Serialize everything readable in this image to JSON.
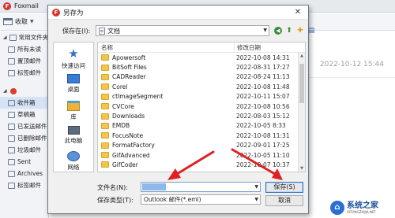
{
  "foxmail": {
    "app_title": "Foxmail",
    "toolbar_inbox_label": "收取",
    "sidebar": [
      {
        "label": "常用文件夹",
        "kind": "group"
      },
      {
        "label": "所有未读",
        "kind": "sub"
      },
      {
        "label": "置顶邮件",
        "kind": "sub"
      },
      {
        "label": "标签邮件",
        "kind": "sub"
      },
      {
        "label": "",
        "kind": "account"
      },
      {
        "label": "收件箱",
        "kind": "sub",
        "highlighted": true
      },
      {
        "label": "草稿箱",
        "kind": "sub"
      },
      {
        "label": "已发送邮件",
        "kind": "sub"
      },
      {
        "label": "已删除邮件",
        "kind": "sub"
      },
      {
        "label": "垃圾邮件",
        "kind": "sub"
      },
      {
        "label": "Sent",
        "kind": "sub"
      },
      {
        "label": "Archives",
        "kind": "sub"
      },
      {
        "label": "标签邮件",
        "kind": "sub"
      }
    ],
    "mail_date": "2022-10-12 15:44"
  },
  "dialog": {
    "title": "另存为",
    "close_label": "✕",
    "save_in_label": "保存在(I):",
    "save_in_value": "文档",
    "places": [
      {
        "label": "快速访问",
        "icon": "star-icon"
      },
      {
        "label": "桌面",
        "icon": "desktop-icon"
      },
      {
        "label": "库",
        "icon": "library-icon"
      },
      {
        "label": "此电脑",
        "icon": "computer-icon"
      },
      {
        "label": "网络",
        "icon": "network-icon"
      }
    ],
    "columns": {
      "name": "名称",
      "date": "修改日期"
    },
    "files": [
      {
        "name": "Apowersoft",
        "date": "2022-10-08 14:31"
      },
      {
        "name": "BitSoft Files",
        "date": "2022-08-31 17:27"
      },
      {
        "name": "CADReader",
        "date": "2022-08-24 11:13"
      },
      {
        "name": "Corel",
        "date": "2022-10-08 11:48"
      },
      {
        "name": "ctImageSegment",
        "date": "2022-10-11 15:07"
      },
      {
        "name": "CVCore",
        "date": "2022-10-08 10:56"
      },
      {
        "name": "Downloads",
        "date": "2022-08-03 15:12"
      },
      {
        "name": "EMDB",
        "date": "2022-10-05 8:33"
      },
      {
        "name": "FocusNote",
        "date": "2022-10-08 11:31"
      },
      {
        "name": "FormatFactory",
        "date": "2022-09-01 17:25"
      },
      {
        "name": "GifAdvanced",
        "date": "2022-10-05 11:10"
      },
      {
        "name": "GifCoder",
        "date": "2022-10-07 10:37"
      }
    ],
    "filename_label": "文件名(N):",
    "filename_value": "",
    "filetype_label": "保存类型(T):",
    "filetype_value": "Outlook 邮件(*.eml)",
    "save_button": "保存(S)",
    "cancel_button": "取消"
  },
  "watermark": {
    "title": "系统之家",
    "sub": "XITONGZHIJIA.NET"
  },
  "colors": {
    "accent": "#2f72c8",
    "annotation": "#e02020",
    "folder": "#f3c54b"
  }
}
